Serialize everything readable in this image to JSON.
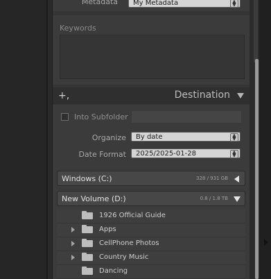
{
  "metadata": {
    "label": "Metadata",
    "value": "My Metadata"
  },
  "keywords": {
    "label": "Keywords"
  },
  "destination": {
    "title": "Destination",
    "into_subfolder_label": "Into Subfolder",
    "organize_label": "Organize",
    "organize_value": "By date",
    "date_format_label": "Date Format",
    "date_format_value": "2025/2025-01-28"
  },
  "volumes": [
    {
      "name": "Windows (C:)",
      "size": "328 / 931 GB"
    },
    {
      "name": "New Volume (D:)",
      "size": "0.8 / 1.8 TB"
    }
  ],
  "folders": [
    {
      "name": "1926 Official Guide"
    },
    {
      "name": "Apps"
    },
    {
      "name": "CellPhone Photos"
    },
    {
      "name": "Country Music"
    },
    {
      "name": "Dancing"
    }
  ]
}
